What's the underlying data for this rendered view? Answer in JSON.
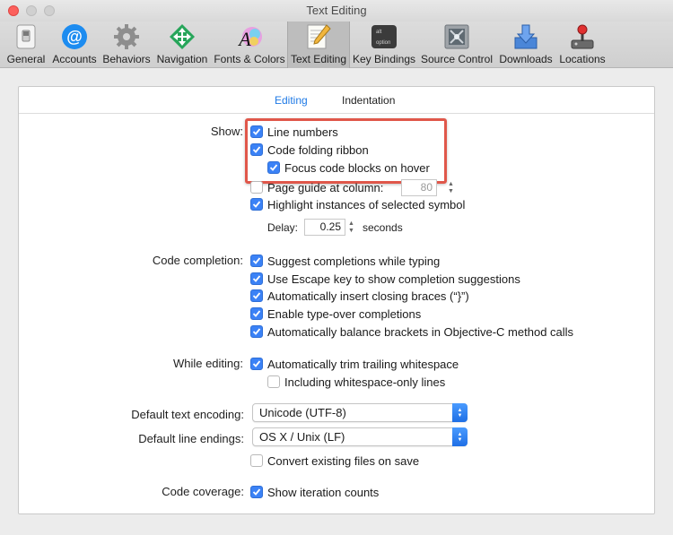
{
  "window": {
    "title": "Text Editing"
  },
  "toolbar": {
    "items": [
      {
        "label": "General",
        "icon": "general-switch-icon"
      },
      {
        "label": "Accounts",
        "icon": "at-sign-icon"
      },
      {
        "label": "Behaviors",
        "icon": "gear-icon"
      },
      {
        "label": "Navigation",
        "icon": "navigation-arrows-icon"
      },
      {
        "label": "Fonts & Colors",
        "icon": "font-color-icon"
      },
      {
        "label": "Text Editing",
        "icon": "text-editing-pencil-icon",
        "selected": true
      },
      {
        "label": "Key Bindings",
        "icon": "option-key-icon"
      },
      {
        "label": "Source Control",
        "icon": "source-control-icon"
      },
      {
        "label": "Downloads",
        "icon": "downloads-icon"
      },
      {
        "label": "Locations",
        "icon": "joystick-icon"
      }
    ]
  },
  "tabs": {
    "editing": "Editing",
    "indentation": "Indentation"
  },
  "show": {
    "label": "Show:",
    "line_numbers": "Line numbers",
    "code_folding_ribbon": "Code folding ribbon",
    "focus_code_blocks": "Focus code blocks on hover",
    "page_guide": "Page guide at column:",
    "page_guide_value": "80",
    "highlight_instances": "Highlight instances of selected symbol",
    "delay_label": "Delay:",
    "delay_value": "0.25",
    "delay_unit": "seconds"
  },
  "code_completion": {
    "label": "Code completion:",
    "items": [
      "Suggest completions while typing",
      "Use Escape key to show completion suggestions",
      "Automatically insert closing braces (“}”)",
      "Enable type-over completions",
      "Automatically balance brackets in Objective-C method calls"
    ]
  },
  "while_editing": {
    "label": "While editing:",
    "trim_whitespace": "Automatically trim trailing whitespace",
    "including_whitespace_only": "Including whitespace-only lines"
  },
  "encoding": {
    "label": "Default text encoding:",
    "value": "Unicode (UTF-8)"
  },
  "line_endings": {
    "label": "Default line endings:",
    "value": "OS X / Unix (LF)"
  },
  "convert_files": "Convert existing files on save",
  "coverage": {
    "label": "Code coverage:",
    "value": "Show iteration counts"
  },
  "colors": {
    "accent": "#3b82f6",
    "highlight_box": "#e0574a",
    "active_tab": "#1f7ae6"
  }
}
